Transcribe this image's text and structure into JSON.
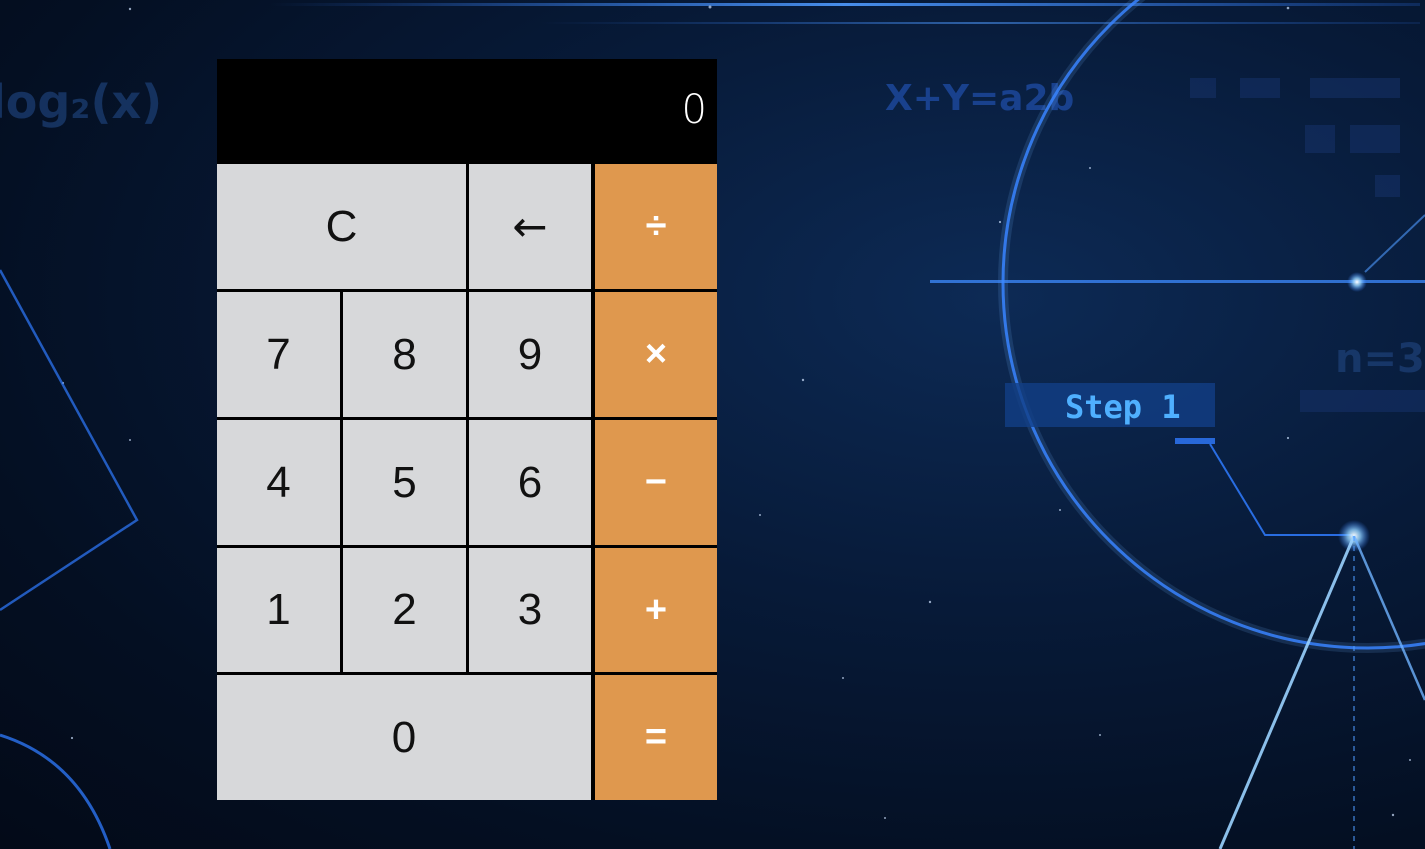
{
  "background": {
    "formulas": [
      "log₂(x)",
      "X+Y=a2b",
      "Step 1",
      "n=3"
    ],
    "accent_color": "#2f7bff"
  },
  "calculator": {
    "display_value": "0",
    "keys": {
      "clear": "C",
      "backspace": "←",
      "divide": "÷",
      "multiply": "×",
      "subtract": "−",
      "add": "+",
      "equals": "=",
      "seven": "7",
      "eight": "8",
      "nine": "9",
      "four": "4",
      "five": "5",
      "six": "6",
      "one": "1",
      "two": "2",
      "three": "3",
      "zero": "0"
    },
    "colors": {
      "number_key": "#d7d8da",
      "operator_key": "#df984e",
      "display_bg": "#000000"
    }
  }
}
